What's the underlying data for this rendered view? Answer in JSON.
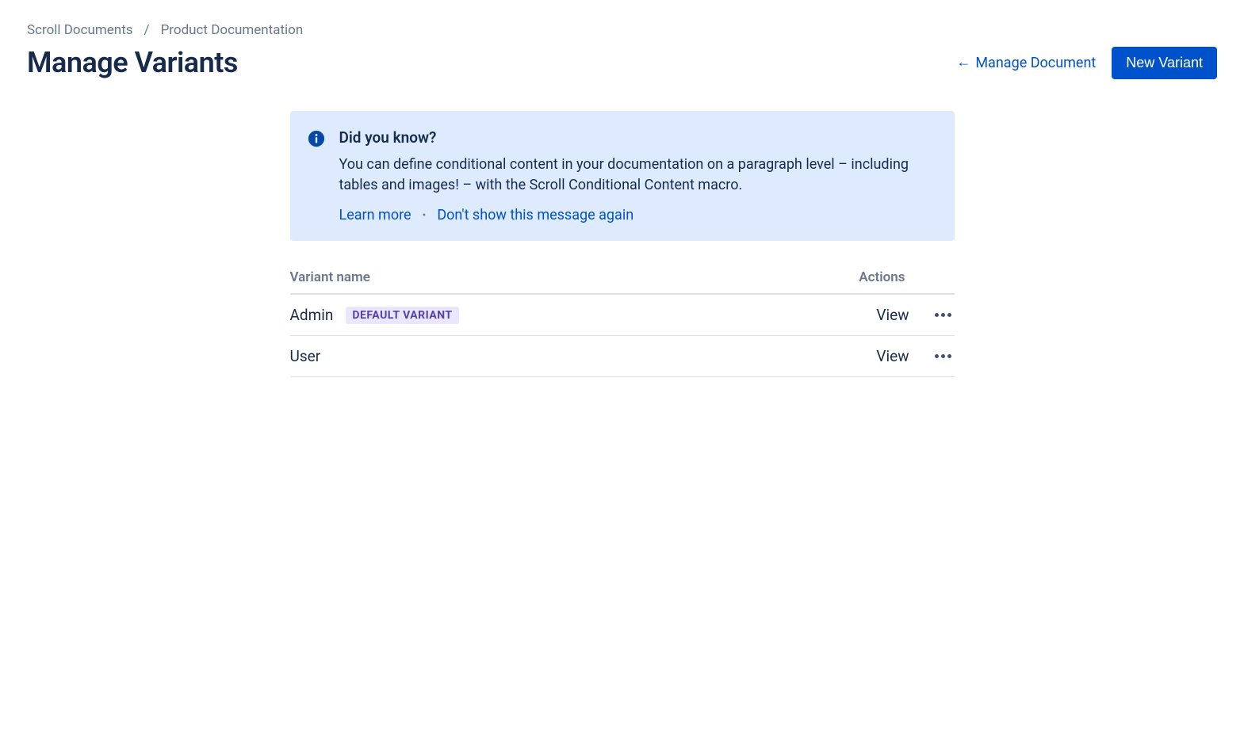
{
  "breadcrumb": {
    "items": [
      "Scroll Documents",
      "Product Documentation"
    ],
    "separator": "/"
  },
  "page": {
    "title": "Manage Variants"
  },
  "header": {
    "manage_document_label": "Manage Document",
    "new_variant_label": "New Variant"
  },
  "info": {
    "title": "Did you know?",
    "body": "You can define conditional content in your documentation on a paragraph level – including tables and images! – with the Scroll Conditional Content macro.",
    "learn_more_label": "Learn more",
    "dismiss_label": "Don't show this message again"
  },
  "table": {
    "columns": {
      "name": "Variant name",
      "actions": "Actions"
    },
    "rows": [
      {
        "name": "Admin",
        "badge": "DEFAULT VARIANT",
        "view_label": "View"
      },
      {
        "name": "User",
        "badge": null,
        "view_label": "View"
      }
    ]
  }
}
